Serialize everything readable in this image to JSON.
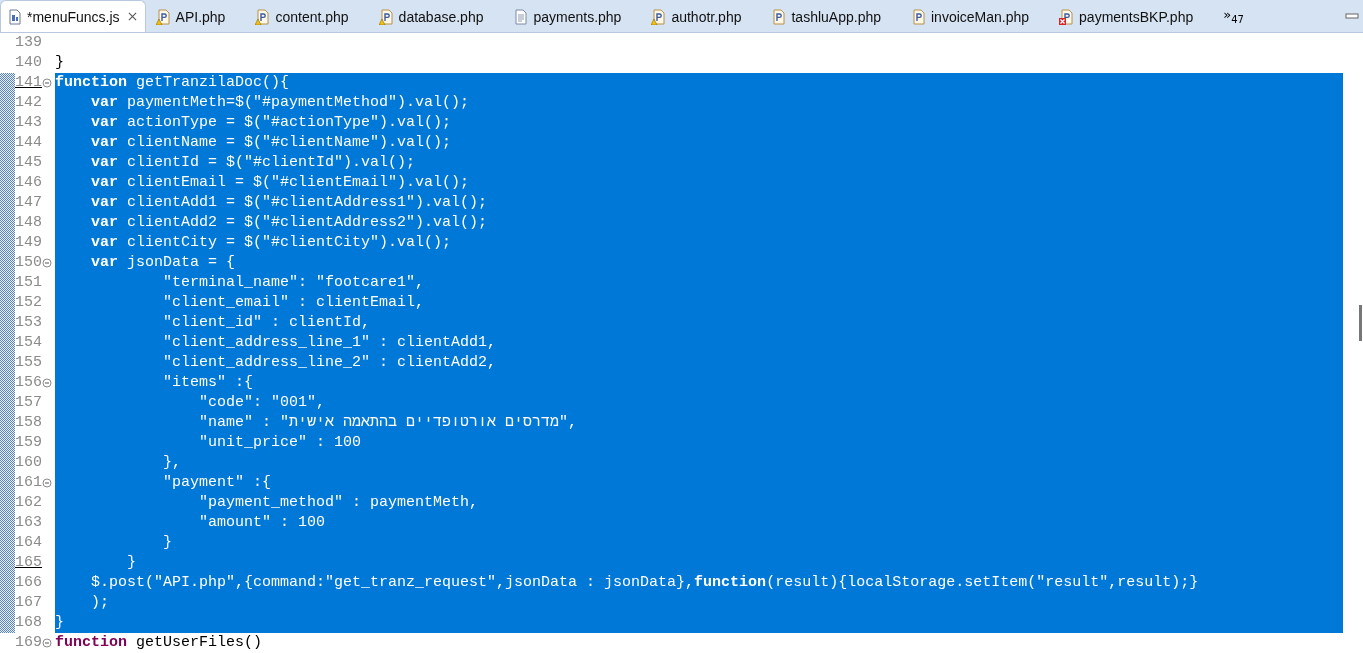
{
  "tabs": [
    {
      "label": "*menuFuncs.js",
      "kind": "js",
      "selected": true,
      "closable": true
    },
    {
      "label": "API.php",
      "kind": "php-warning",
      "selected": false,
      "closable": false
    },
    {
      "label": "content.php",
      "kind": "php-warning",
      "selected": false,
      "closable": false
    },
    {
      "label": "database.php",
      "kind": "php-warning",
      "selected": false,
      "closable": false
    },
    {
      "label": "payments.php",
      "kind": "text",
      "selected": false,
      "closable": false
    },
    {
      "label": "authotr.php",
      "kind": "php-warning",
      "selected": false,
      "closable": false
    },
    {
      "label": "tashluApp.php",
      "kind": "php",
      "selected": false,
      "closable": false
    },
    {
      "label": "invoiceMan.php",
      "kind": "php",
      "selected": false,
      "closable": false
    },
    {
      "label": "paymentsBKP.php",
      "kind": "php-error",
      "selected": false,
      "closable": false
    }
  ],
  "overflow": {
    "chevron": "»",
    "count": "47"
  },
  "lines": [
    {
      "number": "139",
      "selected": false,
      "foldable": false,
      "underlined": false
    },
    {
      "number": "140",
      "code": "}",
      "selected": false,
      "foldable": false,
      "underlined": false
    },
    {
      "number": "141",
      "code": "**function** getTranzilaDoc(){",
      "selected": true,
      "foldable": true,
      "underlined": true
    },
    {
      "number": "142",
      "code": "    **var** paymentMeth=$(\"#paymentMethod\").val();",
      "selected": true,
      "foldable": false,
      "underlined": false
    },
    {
      "number": "143",
      "code": "    **var** actionType = $(\"#actionType\").val();",
      "selected": true,
      "foldable": false,
      "underlined": false
    },
    {
      "number": "144",
      "code": "    **var** clientName = $(\"#clientName\").val();",
      "selected": true,
      "foldable": false,
      "underlined": false
    },
    {
      "number": "145",
      "code": "    **var** clientId = $(\"#clientId\").val();",
      "selected": true,
      "foldable": false,
      "underlined": false
    },
    {
      "number": "146",
      "code": "    **var** clientEmail = $(\"#clientEmail\").val();",
      "selected": true,
      "foldable": false,
      "underlined": false
    },
    {
      "number": "147",
      "code": "    **var** clientAdd1 = $(\"#clientAddress1\").val();",
      "selected": true,
      "foldable": false,
      "underlined": false
    },
    {
      "number": "148",
      "code": "    **var** clientAdd2 = $(\"#clientAddress2\").val();",
      "selected": true,
      "foldable": false,
      "underlined": false
    },
    {
      "number": "149",
      "code": "    **var** clientCity = $(\"#clientCity\").val();",
      "selected": true,
      "foldable": false,
      "underlined": false
    },
    {
      "number": "150",
      "code": "    **var** jsonData = {",
      "selected": true,
      "foldable": true,
      "underlined": false
    },
    {
      "number": "151",
      "code": "            \"terminal_name\": \"footcare1\",",
      "selected": true,
      "foldable": false,
      "underlined": false
    },
    {
      "number": "152",
      "code": "            \"client_email\" : clientEmail,",
      "selected": true,
      "foldable": false,
      "underlined": false
    },
    {
      "number": "153",
      "code": "            \"client_id\" : clientId,",
      "selected": true,
      "foldable": false,
      "underlined": false
    },
    {
      "number": "154",
      "code": "            \"client_address_line_1\" : clientAdd1,",
      "selected": true,
      "foldable": false,
      "underlined": false
    },
    {
      "number": "155",
      "code": "            \"client_address_line_2\" : clientAdd2,",
      "selected": true,
      "foldable": false,
      "underlined": false
    },
    {
      "number": "156",
      "code": "            \"items\" :{",
      "selected": true,
      "foldable": true,
      "underlined": false
    },
    {
      "number": "157",
      "code": "                \"code\": \"001\",",
      "selected": true,
      "foldable": false,
      "underlined": false
    },
    {
      "number": "158",
      "code": "                \"name\" : \"מדרסים אורטופדיים בהתאמה אישית\",",
      "selected": true,
      "foldable": false,
      "underlined": false
    },
    {
      "number": "159",
      "code": "                \"unit_price\" : 100",
      "selected": true,
      "foldable": false,
      "underlined": false
    },
    {
      "number": "160",
      "code": "            },",
      "selected": true,
      "foldable": false,
      "underlined": false
    },
    {
      "number": "161",
      "code": "            \"payment\" :{",
      "selected": true,
      "foldable": true,
      "underlined": false
    },
    {
      "number": "162",
      "code": "                \"payment_method\" : paymentMeth,",
      "selected": true,
      "foldable": false,
      "underlined": false
    },
    {
      "number": "163",
      "code": "                \"amount\" : 100",
      "selected": true,
      "foldable": false,
      "underlined": false
    },
    {
      "number": "164",
      "code": "            }",
      "selected": true,
      "foldable": false,
      "underlined": false
    },
    {
      "number": "165",
      "code": "        }",
      "selected": true,
      "foldable": false,
      "underlined": true
    },
    {
      "number": "166",
      "code": "    $.post(\"API.php\",{command:\"get_tranz_request\",jsonData : jsonData},**function**(result){localStorage.setItem(\"result\",result);}",
      "selected": true,
      "foldable": false,
      "underlined": false
    },
    {
      "number": "167",
      "code": "    );",
      "selected": true,
      "foldable": false,
      "underlined": false
    },
    {
      "number": "168",
      "code": "}",
      "selected": true,
      "foldable": false,
      "underlined": false
    },
    {
      "number": "169",
      "code": "**function** getUserFiles()",
      "selected": false,
      "foldable": true,
      "underlined": false
    }
  ]
}
